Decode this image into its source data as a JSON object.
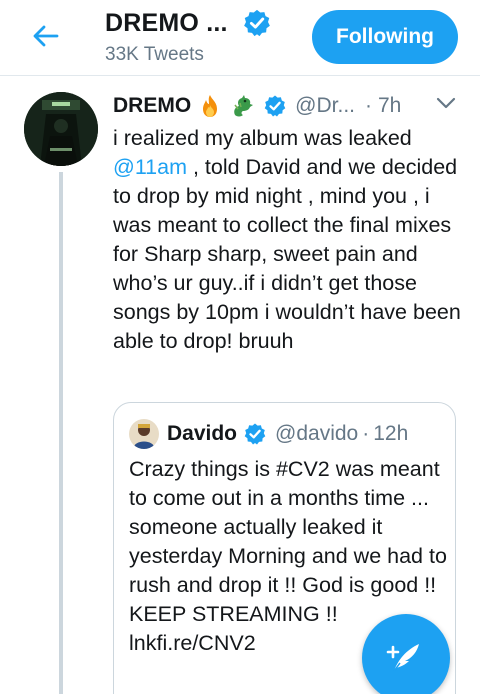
{
  "header": {
    "title": "DREMO ...",
    "subtitle": "33K Tweets",
    "follow_label": "Following"
  },
  "tweet": {
    "name": "DREMO",
    "emojis": [
      "fire-emoji",
      "dragon-emoji"
    ],
    "handle": "@Dr...",
    "separator": "·",
    "time": "7h",
    "text_before": "i realized my album was leaked ",
    "mention": "@11am",
    "text_after": " , told David and we decided to drop by mid night , mind you , i was meant to collect the final mixes for Sharp sharp, sweet pain and who’s ur guy..if i didn’t get those songs by 10pm i wouldn’t have been able to drop! bruuh"
  },
  "quote": {
    "name": "Davido",
    "handle": "@davido",
    "separator": "·",
    "time": "12h",
    "text": "Crazy things is #CV2 was meant to come out in a months time ... someone actually leaked it yesterday Morning and we had to rush and drop it !! God is good !! KEEP STREAMING !! lnkfi.re/CNV2"
  },
  "colors": {
    "accent": "#1da1f2",
    "text": "#14171a",
    "muted": "#657786",
    "border": "#ccd6dd"
  },
  "icons": {
    "back": "arrow-left-icon",
    "verified": "verified-badge-icon",
    "caret": "chevron-down-icon",
    "compose": "compose-tweet-icon"
  }
}
